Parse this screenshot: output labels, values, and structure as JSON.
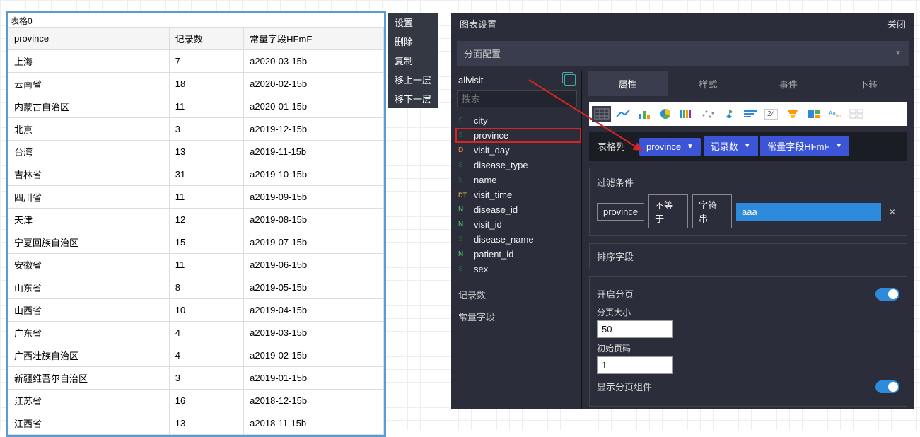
{
  "card": {
    "title": "表格0"
  },
  "table": {
    "headers": [
      "province",
      "记录数",
      "常量字段HFmF"
    ],
    "rows": [
      [
        "上海",
        "7",
        "a2020-03-15b"
      ],
      [
        "云南省",
        "18",
        "a2020-02-15b"
      ],
      [
        "内蒙古自治区",
        "11",
        "a2020-01-15b"
      ],
      [
        "北京",
        "3",
        "a2019-12-15b"
      ],
      [
        "台湾",
        "13",
        "a2019-11-15b"
      ],
      [
        "吉林省",
        "31",
        "a2019-10-15b"
      ],
      [
        "四川省",
        "11",
        "a2019-09-15b"
      ],
      [
        "天津",
        "12",
        "a2019-08-15b"
      ],
      [
        "宁夏回族自治区",
        "15",
        "a2019-07-15b"
      ],
      [
        "安徽省",
        "11",
        "a2019-06-15b"
      ],
      [
        "山东省",
        "8",
        "a2019-05-15b"
      ],
      [
        "山西省",
        "10",
        "a2019-04-15b"
      ],
      [
        "广东省",
        "4",
        "a2019-03-15b"
      ],
      [
        "广西壮族自治区",
        "4",
        "a2019-02-15b"
      ],
      [
        "新疆维吾尔自治区",
        "3",
        "a2019-01-15b"
      ],
      [
        "江苏省",
        "16",
        "a2018-12-15b"
      ],
      [
        "江西省",
        "13",
        "a2018-11-15b"
      ]
    ]
  },
  "ctx": [
    "设置",
    "删除",
    "复制",
    "移上一层",
    "移下一层"
  ],
  "panel": {
    "title": "图表设置",
    "close": "关闭",
    "section": "分面配置"
  },
  "fields": {
    "dsname": "allvisit",
    "search_ph": "搜索",
    "list": [
      {
        "t": "S",
        "n": "city"
      },
      {
        "t": "S",
        "n": "province",
        "hl": true
      },
      {
        "t": "D",
        "n": "visit_day"
      },
      {
        "t": "S",
        "n": "disease_type"
      },
      {
        "t": "S",
        "n": "name"
      },
      {
        "t": "DT",
        "n": "visit_time"
      },
      {
        "t": "N",
        "n": "disease_id"
      },
      {
        "t": "N",
        "n": "visit_id"
      },
      {
        "t": "S",
        "n": "disease_name"
      },
      {
        "t": "N",
        "n": "patient_id"
      },
      {
        "t": "S",
        "n": "sex"
      }
    ],
    "groups": [
      "记录数",
      "常量字段"
    ]
  },
  "annot_num": "5",
  "tabs": [
    "属性",
    "样式",
    "事件",
    "下转"
  ],
  "tabs_active": 0,
  "charttypes": [
    "table",
    "line",
    "bar",
    "pie",
    "colbar",
    "scatter",
    "rose",
    "list",
    "num24",
    "funnel",
    "tree",
    "word",
    "grid"
  ],
  "num_thumb": "24",
  "colbar": {
    "label": "表格列",
    "pills": [
      "province",
      "记录数",
      "常量字段HFmF"
    ]
  },
  "filter": {
    "title": "过滤条件",
    "field": "province",
    "op": "不等于",
    "type": "字符串",
    "value": "aaa",
    "x": "×"
  },
  "sort": {
    "title": "排序字段"
  },
  "paging": {
    "enable_label": "开启分页",
    "size_label": "分页大小",
    "size_value": "50",
    "init_label": "初始页码",
    "init_value": "1",
    "show_label": "显示分页组件"
  }
}
